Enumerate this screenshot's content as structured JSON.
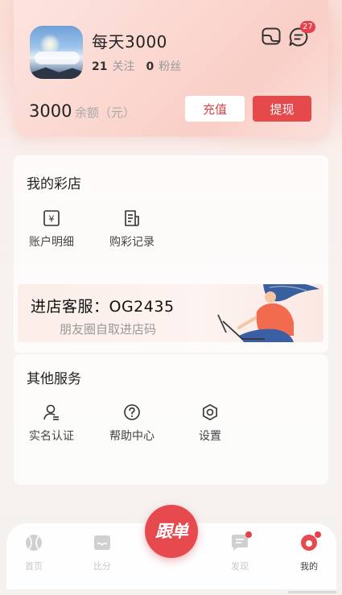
{
  "profile": {
    "username": "每天3000",
    "following_count": "21",
    "following_label": "关注",
    "followers_count": "0",
    "followers_label": "粉丝",
    "message_badge": "27",
    "icons": [
      "coupon-icon",
      "message-icon"
    ]
  },
  "balance": {
    "amount": "3000",
    "label": "余额（元）",
    "recharge_label": "充值",
    "withdraw_label": "提现"
  },
  "store": {
    "title": "我的彩店",
    "items": [
      {
        "label": "账户明细",
        "icon": "account-detail-icon"
      },
      {
        "label": "购彩记录",
        "icon": "purchase-record-icon"
      }
    ],
    "banner": {
      "title": "进店客服：OG2435",
      "subtitle": "朋友圈自取进店码"
    }
  },
  "services": {
    "title": "其他服务",
    "items": [
      {
        "label": "实名认证",
        "icon": "user-verify-icon"
      },
      {
        "label": "帮助中心",
        "icon": "help-icon"
      },
      {
        "label": "设置",
        "icon": "settings-icon"
      }
    ]
  },
  "tabbar": {
    "center_label": "跟单",
    "tabs": [
      {
        "label": "首页",
        "icon": "home-ball-icon",
        "active": false
      },
      {
        "label": "比分",
        "icon": "score-icon",
        "active": false
      },
      {
        "label": "发现",
        "icon": "discover-icon",
        "active": false,
        "dot": true
      },
      {
        "label": "我的",
        "icon": "profile-icon",
        "active": true,
        "dot": true
      }
    ]
  },
  "colors": {
    "accent": "#e6494c",
    "badge": "#e8404a",
    "header_bg": "#fbd7d0"
  }
}
